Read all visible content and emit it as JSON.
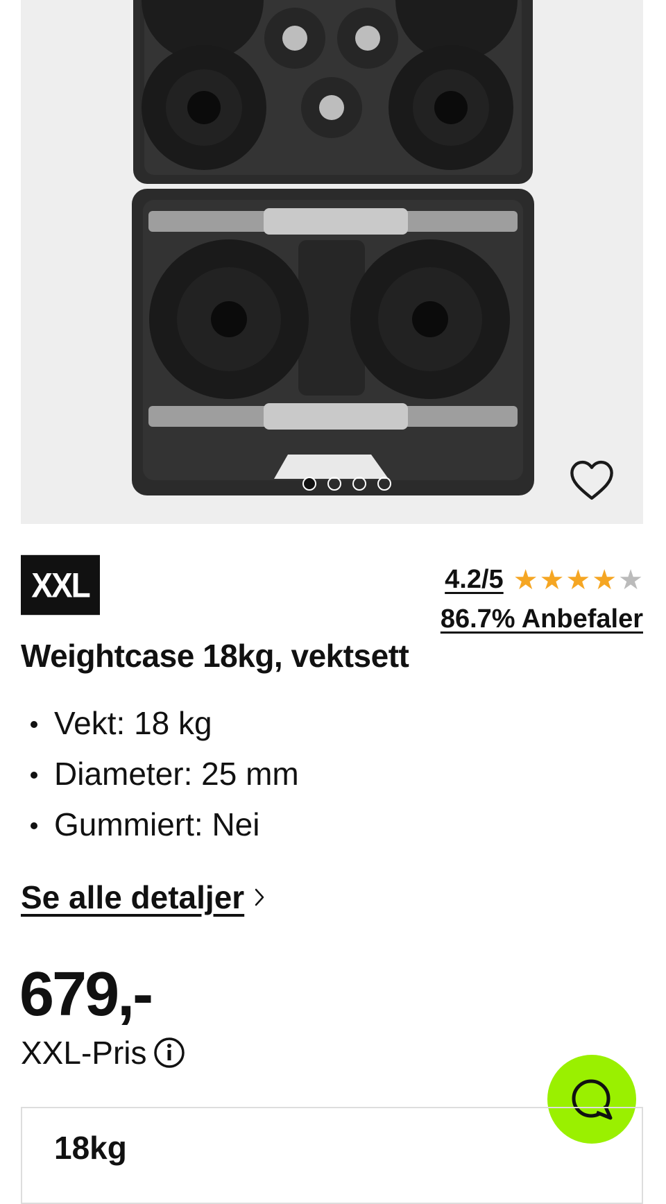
{
  "product": {
    "brand": "XXL",
    "title": "Weightcase 18kg, vektsett",
    "rating": {
      "score_text": "4.2/5",
      "stars_value": 4.2,
      "stars_max": 5,
      "recommend_text": "86.7% Anbefaler"
    },
    "specs": [
      "Vekt: 18 kg",
      "Diameter: 25 mm",
      "Gummiert: Nei"
    ],
    "details_link": "Se alle detaljer",
    "price": "679,-",
    "price_label": "XXL-Pris",
    "variant": "18kg"
  },
  "gallery": {
    "image_count": 4,
    "active_index": 0
  },
  "icons": {
    "favorite": "heart-outline-icon",
    "info": "info-icon",
    "chevron": "chevron-right-icon",
    "chat": "chat-icon"
  },
  "colors": {
    "accent_green": "#9af000",
    "star": "#f5a623",
    "star_empty": "#bbbbbb",
    "logo_bg": "#111111"
  }
}
